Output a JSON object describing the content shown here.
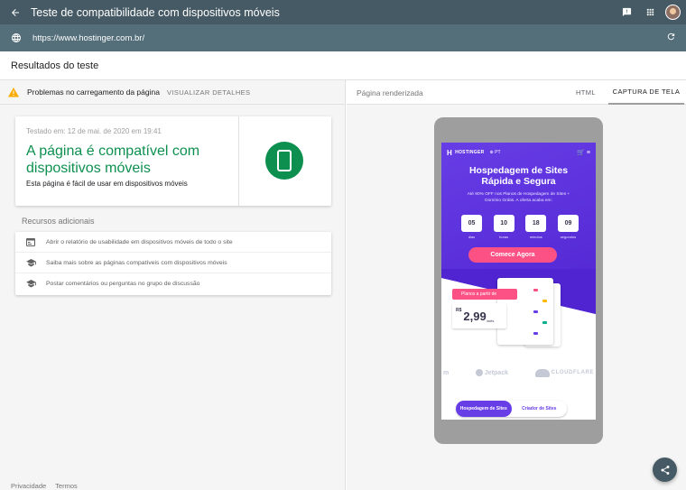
{
  "topbar": {
    "title": "Teste de compatibilidade com dispositivos móveis",
    "icons": [
      "arrow-back-icon",
      "feedback-icon",
      "apps-icon",
      "avatar"
    ]
  },
  "urlbar": {
    "url": "https://www.hostinger.com.br/",
    "icons": [
      "globe-icon",
      "refresh-icon"
    ]
  },
  "results": {
    "title": "Resultados do teste"
  },
  "warning": {
    "text": "Problemas no carregamento da página",
    "action": "VISUALIZAR DETALHES"
  },
  "summary": {
    "tested": "Testado em: 12 de mai. de 2020 em 19:41",
    "verdict": "A página é compatível com dispositivos móveis",
    "description": "Esta página é fácil de usar em dispositivos móveis"
  },
  "resources": {
    "title": "Recursos adicionais",
    "items": [
      {
        "icon": "report-icon",
        "label": "Abrir o relatório de usabilidade em dispositivos móveis de todo o site"
      },
      {
        "icon": "school-icon",
        "label": "Saiba mais sobre as páginas compatíveis com dispositivos móveis"
      },
      {
        "icon": "school-icon",
        "label": "Postar comentários ou perguntas no grupo de discussão"
      }
    ]
  },
  "footer": {
    "privacy": "Privacidade",
    "terms": "Termos"
  },
  "preview": {
    "label": "Página renderizada",
    "tabs": [
      "HTML",
      "CAPTURA DE TELA"
    ],
    "active_tab": "CAPTURA DE TELA"
  },
  "site": {
    "logo": "HOSTINGER",
    "lang": "PT",
    "headline_1": "Hospedagem de Sites",
    "headline_2": "Rápida e Segura",
    "offer_1": "Até 90% OFF nos Planos de Hospedagem de Sites +",
    "offer_2": "Domínio Grátis. A oferta acaba em:",
    "countdown": [
      {
        "value": "05",
        "unit": "dias"
      },
      {
        "value": "10",
        "unit": "horas"
      },
      {
        "value": "18",
        "unit": "minutos"
      },
      {
        "value": "09",
        "unit": "segundos"
      }
    ],
    "cta": "Comece Agora",
    "price_label": "Planos a partir de",
    "currency": "R$",
    "price": "2,99",
    "period": "/mês",
    "partners": [
      "m",
      "Jetpack",
      "CLOUDFLARE"
    ],
    "pills": [
      "Hospedagem de Sites",
      "Criador de Sites"
    ],
    "colors": {
      "brand": "#673de6",
      "accent": "#fc5185"
    }
  },
  "colors": {
    "topbar": "#455a64",
    "pass": "#0d904f",
    "warning": "#f9ab00"
  }
}
